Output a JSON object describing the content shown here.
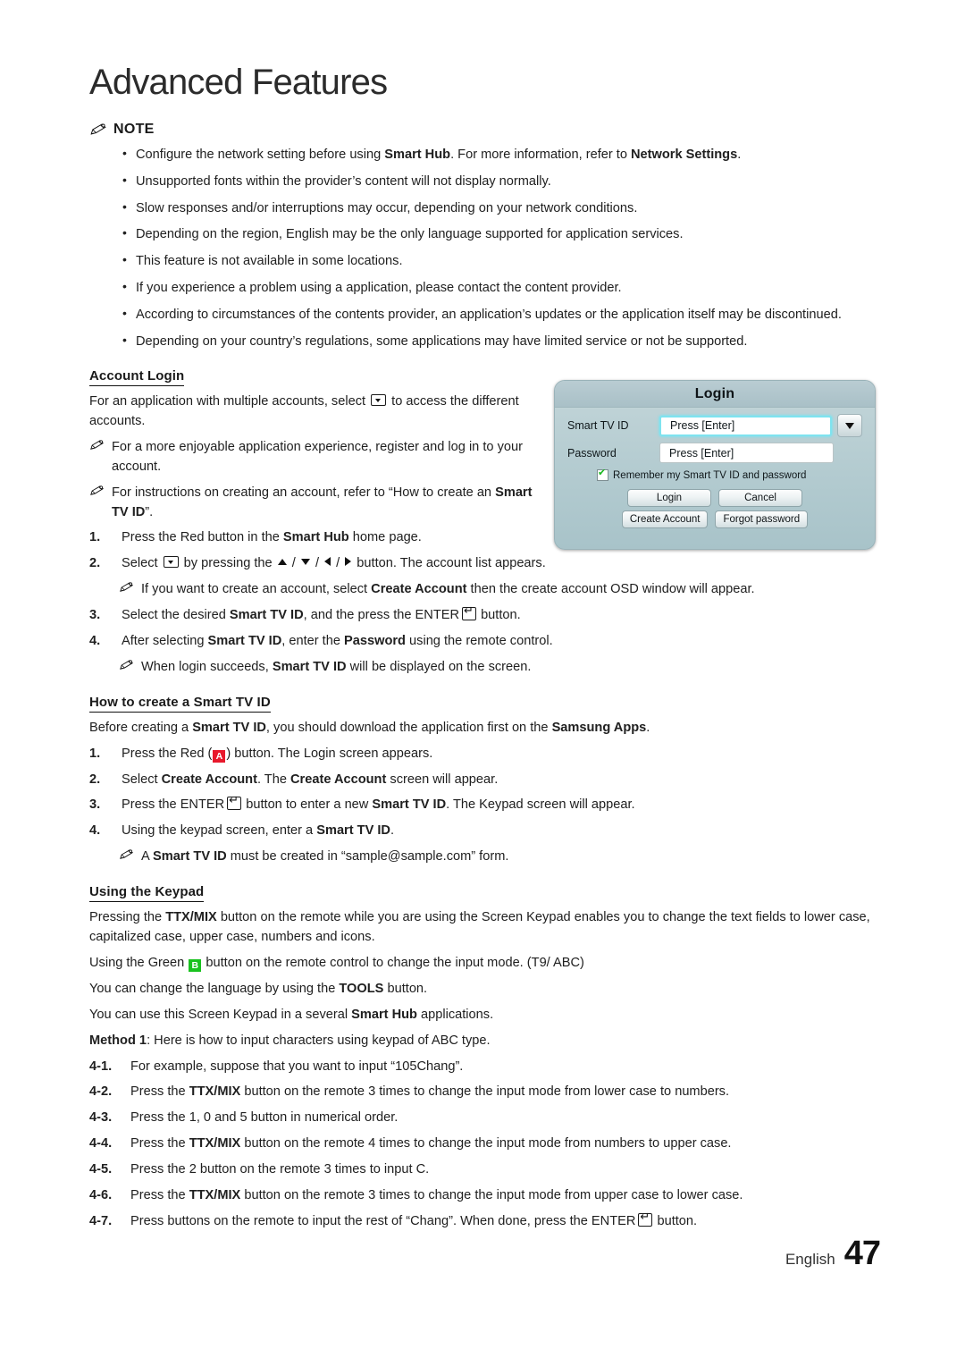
{
  "chapter": {
    "title": "Advanced Features"
  },
  "note": {
    "icon": "pencil-note-icon",
    "label": "NOTE",
    "items": [
      {
        "parts": [
          {
            "t": "Configure the network setting before using "
          },
          {
            "t": "Smart Hub",
            "b": true
          },
          {
            "t": ". For more information, refer to "
          },
          {
            "t": "Network Settings",
            "b": true
          },
          {
            "t": "."
          }
        ]
      },
      {
        "parts": [
          {
            "t": "Unsupported fonts within the provider’s content will not display normally."
          }
        ]
      },
      {
        "parts": [
          {
            "t": "Slow responses and/or interruptions may occur, depending on your network conditions."
          }
        ]
      },
      {
        "parts": [
          {
            "t": "Depending on the region, English may be the only language supported for application services."
          }
        ]
      },
      {
        "parts": [
          {
            "t": "This feature is not available in some locations."
          }
        ]
      },
      {
        "parts": [
          {
            "t": "If you experience a problem using a application, please contact the content provider."
          }
        ]
      },
      {
        "parts": [
          {
            "t": "According to circumstances of the contents provider, an application’s updates or the application itself may be discontinued."
          }
        ]
      },
      {
        "parts": [
          {
            "t": "Depending on your country’s regulations, some applications may have limited service or not be supported."
          }
        ]
      }
    ]
  },
  "account_login": {
    "heading": "Account Login",
    "intro": [
      {
        "t": "For an application with multiple accounts, select "
      },
      {
        "g": "dropdown"
      },
      {
        "t": " to access the different accounts."
      }
    ],
    "notes": [
      {
        "parts": [
          {
            "t": "For a more enjoyable application experience, register and log in to your account."
          }
        ]
      },
      {
        "parts": [
          {
            "t": "For instructions on creating an account, refer to “How to create an "
          },
          {
            "t": "Smart TV ID",
            "b": true
          },
          {
            "t": "”."
          }
        ]
      }
    ],
    "steps": [
      {
        "num": "1.",
        "parts": [
          {
            "t": "Press the Red button in the "
          },
          {
            "t": "Smart Hub",
            "b": true
          },
          {
            "t": " home page."
          }
        ]
      },
      {
        "num": "2.",
        "parts": [
          {
            "t": "Select "
          },
          {
            "g": "dropdown"
          },
          {
            "t": " by pressing the "
          },
          {
            "g": "up"
          },
          {
            "t": " / "
          },
          {
            "g": "down"
          },
          {
            "t": " / "
          },
          {
            "g": "left"
          },
          {
            "t": " / "
          },
          {
            "g": "right"
          },
          {
            "t": " button. The account list appears."
          }
        ]
      }
    ],
    "step2_note": {
      "parts": [
        {
          "t": "If you want to create an account, select "
        },
        {
          "t": "Create Account",
          "b": true
        },
        {
          "t": " then the create account OSD window will appear."
        }
      ]
    },
    "steps_cont": [
      {
        "num": "3.",
        "parts": [
          {
            "t": "Select the desired "
          },
          {
            "t": "Smart TV ID",
            "b": true
          },
          {
            "t": ", and the press the ENTER"
          },
          {
            "g": "enter"
          },
          {
            "t": " button."
          }
        ]
      },
      {
        "num": "4.",
        "parts": [
          {
            "t": "After selecting "
          },
          {
            "t": "Smart TV ID",
            "b": true
          },
          {
            "t": ", enter the "
          },
          {
            "t": "Password",
            "b": true
          },
          {
            "t": " using the remote control."
          }
        ]
      }
    ],
    "step4_note": {
      "parts": [
        {
          "t": "When login succeeds, "
        },
        {
          "t": "Smart TV ID",
          "b": true
        },
        {
          "t": " will be displayed on the screen."
        }
      ]
    }
  },
  "login_osd": {
    "title": "Login",
    "id_label": "Smart TV ID",
    "id_value": "Press [Enter]",
    "password_label": "Password",
    "password_value": "Press [Enter]",
    "dropdown_icon": "chevron-down-icon",
    "remember_label": "Remember my Smart TV ID and password",
    "remember_checked": true,
    "buttons": {
      "login": "Login",
      "cancel": "Cancel",
      "create_account": "Create Account",
      "forgot_password": "Forgot password"
    },
    "accent_focus": "#7fe3ef",
    "check_color": "#19b81f"
  },
  "create_id": {
    "heading": "How to create a Smart TV ID",
    "intro": [
      {
        "t": "Before creating a "
      },
      {
        "t": "Smart TV ID",
        "b": true
      },
      {
        "t": ", you should download the application first on the "
      },
      {
        "t": "Samsung Apps",
        "b": true
      },
      {
        "t": "."
      }
    ],
    "steps": [
      {
        "num": "1.",
        "parts": [
          {
            "t": "Press the Red ("
          },
          {
            "g": "badge-a"
          },
          {
            "t": ") button. The Login screen appears."
          }
        ]
      },
      {
        "num": "2.",
        "parts": [
          {
            "t": "Select "
          },
          {
            "t": "Create Account",
            "b": true
          },
          {
            "t": ". The "
          },
          {
            "t": "Create Account",
            "b": true
          },
          {
            "t": " screen will appear."
          }
        ]
      },
      {
        "num": "3.",
        "parts": [
          {
            "t": "Press the ENTER"
          },
          {
            "g": "enter"
          },
          {
            "t": " button to enter a new "
          },
          {
            "t": "Smart TV ID",
            "b": true
          },
          {
            "t": ". The Keypad screen will appear."
          }
        ]
      },
      {
        "num": "4.",
        "parts": [
          {
            "t": "Using the keypad screen, enter a "
          },
          {
            "t": "Smart TV ID",
            "b": true
          },
          {
            "t": "."
          }
        ]
      }
    ],
    "step4_note": {
      "parts": [
        {
          "t": "A "
        },
        {
          "t": "Smart TV ID",
          "b": true
        },
        {
          "t": " must be created in “sample@sample.com” form."
        }
      ]
    },
    "badge_a_label": "A",
    "badge_a_color": "#e8192c"
  },
  "keypad": {
    "heading": "Using the Keypad",
    "paragraphs": [
      {
        "parts": [
          {
            "t": "Pressing the "
          },
          {
            "t": "TTX/MIX",
            "b": true
          },
          {
            "t": " button on the remote while you are using the Screen Keypad enables you to change the text fields to lower case, capitalized case, upper case, numbers and icons."
          }
        ]
      },
      {
        "parts": [
          {
            "t": "Using the Green "
          },
          {
            "g": "badge-b"
          },
          {
            "t": " button on the remote control to change the input mode. (T9/ ABC)"
          }
        ]
      },
      {
        "parts": [
          {
            "t": "You can change the language by using the "
          },
          {
            "t": "TOOLS",
            "b": true
          },
          {
            "t": " button."
          }
        ]
      },
      {
        "parts": [
          {
            "t": "You can use this Screen Keypad in a several "
          },
          {
            "t": "Smart Hub",
            "b": true
          },
          {
            "t": " applications."
          }
        ]
      },
      {
        "parts": [
          {
            "t": "Method 1",
            "b": true
          },
          {
            "t": ": Here is how to input characters using keypad of ABC type."
          }
        ]
      }
    ],
    "badge_b_label": "B",
    "badge_b_color": "#19c21f",
    "steps": [
      {
        "num": "4-1.",
        "parts": [
          {
            "t": "For example, suppose that you want to input “105Chang”."
          }
        ]
      },
      {
        "num": "4-2.",
        "parts": [
          {
            "t": "Press the "
          },
          {
            "t": "TTX/MIX",
            "b": true
          },
          {
            "t": " button on the remote 3 times to change the input mode from lower case to numbers."
          }
        ]
      },
      {
        "num": "4-3.",
        "parts": [
          {
            "t": "Press the 1, 0 and 5 button in numerical order."
          }
        ]
      },
      {
        "num": "4-4.",
        "parts": [
          {
            "t": "Press the "
          },
          {
            "t": "TTX/MIX",
            "b": true
          },
          {
            "t": " button on the remote 4 times to change the input mode from numbers to upper case."
          }
        ]
      },
      {
        "num": "4-5.",
        "parts": [
          {
            "t": "Press the 2 button on the remote 3 times to input C."
          }
        ]
      },
      {
        "num": "4-6.",
        "parts": [
          {
            "t": "Press the "
          },
          {
            "t": "TTX/MIX",
            "b": true
          },
          {
            "t": " button on the remote 3 times to change the input mode from upper case to lower case."
          }
        ]
      },
      {
        "num": "4-7.",
        "parts": [
          {
            "t": "Press buttons on the remote to input the rest of “Chang”. When done, press the ENTER"
          },
          {
            "g": "enter"
          },
          {
            "t": " button."
          }
        ]
      }
    ]
  },
  "footer": {
    "language": "English",
    "page_number": "47"
  }
}
